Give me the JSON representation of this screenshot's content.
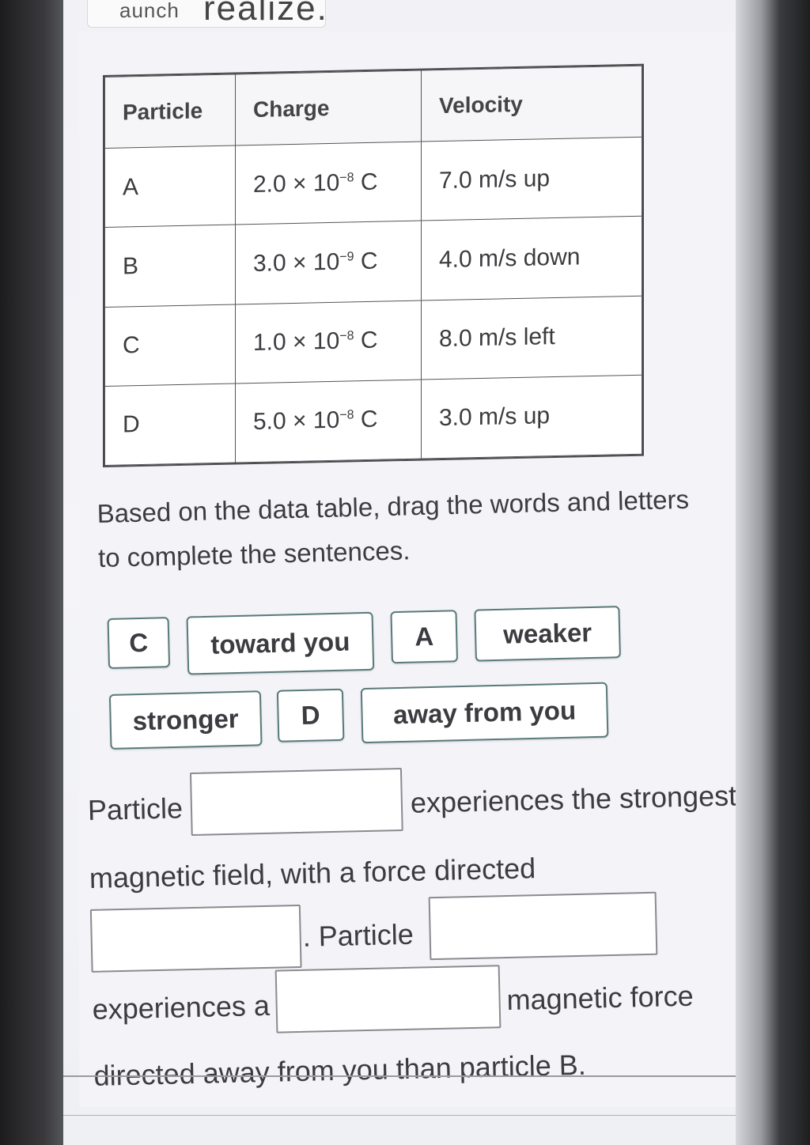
{
  "header": {
    "launch_label": "aunch",
    "brand": "realize."
  },
  "table": {
    "headers": [
      "Particle",
      "Charge",
      "Velocity"
    ],
    "rows": [
      {
        "particle": "A",
        "charge_mantissa": "2.0 × 10",
        "charge_exp": "−8",
        "charge_unit": " C",
        "velocity": "7.0 m/s up"
      },
      {
        "particle": "B",
        "charge_mantissa": "3.0 × 10",
        "charge_exp": "−9",
        "charge_unit": " C",
        "velocity": "4.0 m/s down"
      },
      {
        "particle": "C",
        "charge_mantissa": "1.0 × 10",
        "charge_exp": "−8",
        "charge_unit": " C",
        "velocity": "8.0 m/s left"
      },
      {
        "particle": "D",
        "charge_mantissa": "5.0 × 10",
        "charge_exp": "−8",
        "charge_unit": " C",
        "velocity": "3.0 m/s up"
      }
    ]
  },
  "instructions": {
    "line1": "Based on the data table, drag the words and letters",
    "line2": "to complete the sentences."
  },
  "chips": [
    "C",
    "toward you",
    "A",
    "weaker",
    "stronger",
    "D",
    "away from you"
  ],
  "sentence": {
    "part1": "Particle",
    "part2": "experiences the strongest",
    "part3": "magnetic field, with a force directed",
    "part4": ". Particle",
    "part5": "experiences a",
    "part6": "magnetic force",
    "part7": "directed away from you than particle B."
  }
}
